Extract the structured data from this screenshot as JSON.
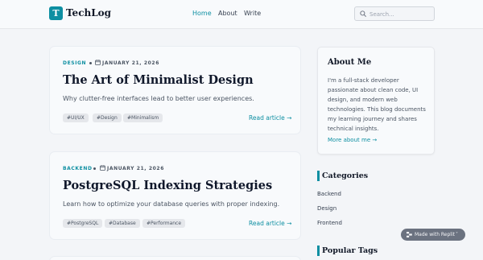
{
  "header": {
    "logo_letter": "T",
    "brand": "TechLog",
    "nav": [
      {
        "label": "Home",
        "active": true
      },
      {
        "label": "About",
        "active": false
      },
      {
        "label": "Write",
        "active": false
      }
    ],
    "search_placeholder": "Search..."
  },
  "posts": [
    {
      "category": "DESIGN",
      "date": "JANUARY 21, 2026",
      "title": "The Art of Minimalist Design",
      "description": "Why clutter-free interfaces lead to better user experiences.",
      "tags": [
        "#UI/UX",
        "#Design",
        "#Minimalism"
      ],
      "read_more": "Read article →"
    },
    {
      "category": "BACKEND",
      "date": "JANUARY 21, 2026",
      "title": "PostgreSQL Indexing Strategies",
      "description": "Learn how to optimize your database queries with proper indexing.",
      "tags": [
        "#PostgreSQL",
        "#Database",
        "#Performance"
      ],
      "read_more": "Read article →"
    }
  ],
  "sidebar": {
    "about": {
      "title": "About Me",
      "lines": [
        "I'm a full-stack developer",
        "passionate about clean code, UI",
        "design, and modern web",
        "technologies. This blog documents",
        "my learning journey and shares",
        "technical insights."
      ],
      "link": "More about me →"
    },
    "categories_title": "Categories",
    "categories": [
      "Backend",
      "Design",
      "Frontend"
    ],
    "popular_tags_title": "Popular Tags"
  },
  "badge": {
    "label": "Made with Replit",
    "close": "˅"
  },
  "colors": {
    "accent": "#0e8fa2",
    "background": "#f3f5f8",
    "card": "#f8fafc",
    "tag_bg": "#e5e7eb"
  },
  "icons": [
    "search-icon",
    "calendar-icon",
    "replit-icon",
    "chevron-down-icon"
  ]
}
